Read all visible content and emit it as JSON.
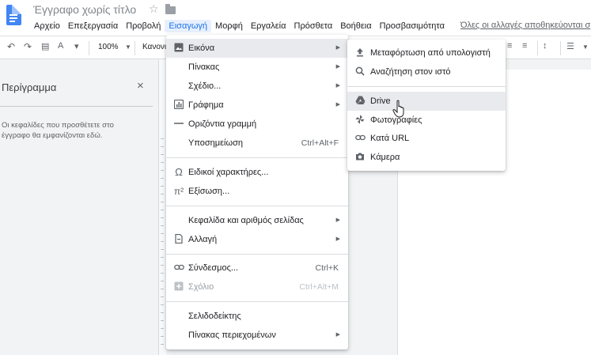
{
  "header": {
    "title": "Έγγραφο χωρίς τίτλο",
    "save_status": "Όλες οι αλλαγές αποθηκεύονται σ",
    "menu": [
      {
        "label": "Αρχείο"
      },
      {
        "label": "Επεξεργασία"
      },
      {
        "label": "Προβολή"
      },
      {
        "label": "Εισαγωγή",
        "active": true
      },
      {
        "label": "Μορφή"
      },
      {
        "label": "Εργαλεία"
      },
      {
        "label": "Πρόσθετα"
      },
      {
        "label": "Βοήθεια"
      },
      {
        "label": "Προσβασιμότητα"
      }
    ]
  },
  "toolbar": {
    "zoom": "100%",
    "style": "Κανονι"
  },
  "outline": {
    "title": "Περίγραμμα",
    "close": "×",
    "empty_text": "Οι κεφαλίδες που προσθέτετε στο έγγραφο θα εμφανίζονται εδώ."
  },
  "insert_menu": {
    "items": [
      {
        "label": "Εικόνα",
        "icon": "image-icon",
        "arrow": true,
        "highlighted": true
      },
      {
        "label": "Πίνακας",
        "arrow": true
      },
      {
        "label": "Σχέδιο...",
        "arrow": true
      },
      {
        "label": "Γράφημα",
        "icon": "chart-icon",
        "arrow": true
      },
      {
        "label": "Οριζόντια γραμμή",
        "icon": "horizontal-line-icon"
      },
      {
        "label": "Υποσημείωση",
        "shortcut": "Ctrl+Alt+F"
      },
      {
        "label": "Ειδικοί χαρακτήρες...",
        "icon": "omega-icon"
      },
      {
        "label": "Εξίσωση...",
        "icon": "pi-icon"
      },
      {
        "label": "Κεφαλίδα και αριθμός σελίδας",
        "arrow": true
      },
      {
        "label": "Αλλαγή",
        "icon": "page-break-icon",
        "arrow": true
      },
      {
        "label": "Σύνδεσμος...",
        "icon": "link-icon",
        "shortcut": "Ctrl+K"
      },
      {
        "label": "Σχόλιο",
        "icon": "comment-icon",
        "shortcut": "Ctrl+Alt+M",
        "disabled": true
      },
      {
        "label": "Σελιδοδείκτης"
      },
      {
        "label": "Πίνακας περιεχομένων",
        "arrow": true
      }
    ]
  },
  "image_submenu": {
    "items": [
      {
        "label": "Μεταφόρτωση από υπολογιστή",
        "icon": "upload-icon"
      },
      {
        "label": "Αναζήτηση στον ιστό",
        "icon": "search-icon"
      },
      {
        "label": "Drive",
        "icon": "drive-icon",
        "highlighted": true
      },
      {
        "label": "Φωτογραφίες",
        "icon": "photos-icon"
      },
      {
        "label": "Κατά URL",
        "icon": "link-icon"
      },
      {
        "label": "Κάμερα",
        "icon": "camera-icon"
      }
    ]
  },
  "colors": {
    "accent": "#1a73e8",
    "menu_highlight": "#e8eaed",
    "doc_icon": "#4285f4"
  }
}
